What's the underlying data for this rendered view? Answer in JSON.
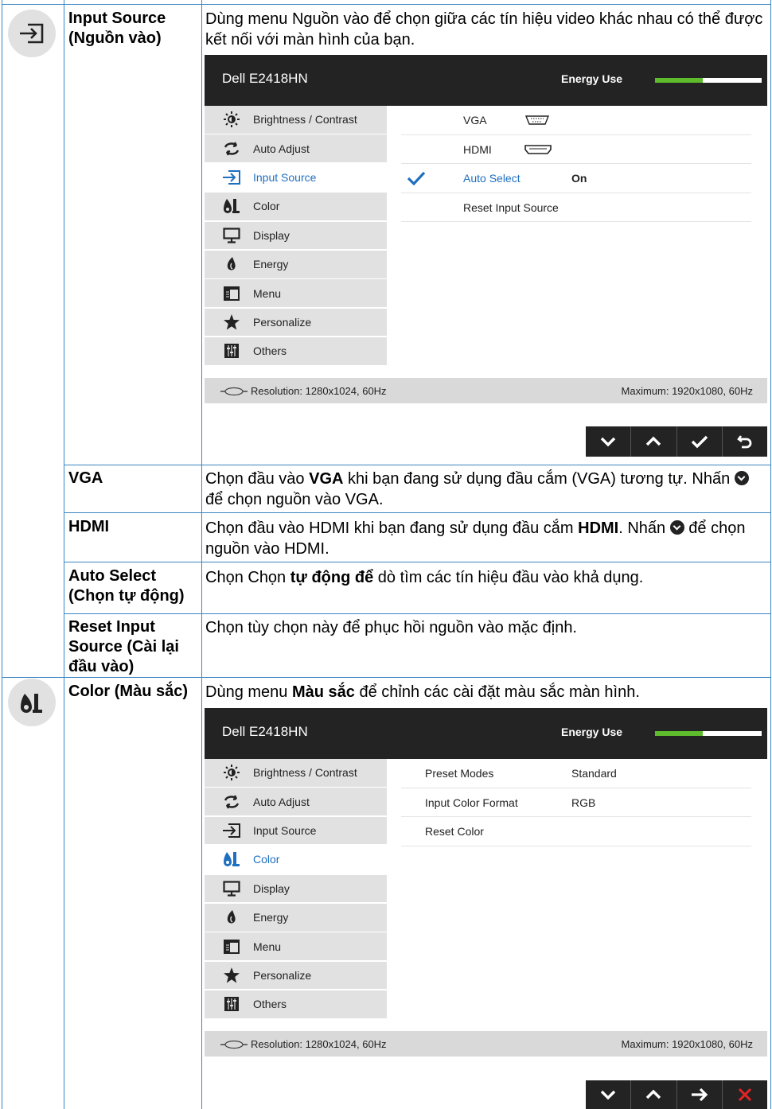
{
  "section1": {
    "label": "Input Source (Nguồn vào)",
    "description": "Dùng menu Nguồn vào để chọn giữa các tín hiệu video khác nhau có thể được kết nối với màn hình của bạn.",
    "osd": {
      "model": "Dell E2418HN",
      "energy_label": "Energy Use",
      "energy_level": 0.45,
      "menu": [
        "Brightness / Contrast",
        "Auto Adjust",
        "Input Source",
        "Color",
        "Display",
        "Energy",
        "Menu",
        "Personalize",
        "Others"
      ],
      "active_index": 2,
      "submenu": {
        "vga": "VGA",
        "hdmi": "HDMI",
        "auto_select": "Auto Select",
        "auto_select_value": "On",
        "reset": "Reset Input Source"
      },
      "resolution": "Resolution: 1280x1024, 60Hz",
      "maximum": "Maximum: 1920x1080, 60Hz"
    },
    "rows": [
      {
        "label": "VGA",
        "pre": "Chọn đầu vào ",
        "bold": "VGA",
        "post": " khi bạn đang sử dụng đầu cắm (VGA) tương tự. Nhấn ",
        "tail": " để chọn nguồn vào VGA."
      },
      {
        "label": "HDMI",
        "pre": "Chọn đầu vào HDMI khi bạn đang sử dụng đầu cắm ",
        "bold": "HDMI",
        "post": ". Nhấn ",
        "tail": " để chọn nguồn vào HDMI."
      },
      {
        "label": "Auto Select (Chọn tự động)",
        "pre": "Chọn Chọn ",
        "bold": "tự động để",
        "post": " dò tìm các tín hiệu đầu vào khả dụng."
      },
      {
        "label": "Reset Input Source (Cài lại đầu vào)",
        "pre": "Chọn tùy chọn này để phục hồi nguồn vào mặc định."
      }
    ]
  },
  "section2": {
    "label": "Color (Màu sắc)",
    "desc_pre": "Dùng menu ",
    "desc_bold": "Màu sắc",
    "desc_post": " để chỉnh các cài đặt màu sắc màn hình.",
    "osd": {
      "model": "Dell E2418HN",
      "energy_label": "Energy Use",
      "energy_level": 0.45,
      "menu": [
        "Brightness / Contrast",
        "Auto Adjust",
        "Input Source",
        "Color",
        "Display",
        "Energy",
        "Menu",
        "Personalize",
        "Others"
      ],
      "active_index": 3,
      "submenu": [
        {
          "name": "Preset Modes",
          "value": "Standard"
        },
        {
          "name": "Input Color Format",
          "value": "RGB"
        },
        {
          "name": "Reset Color",
          "value": ""
        }
      ],
      "resolution": "Resolution: 1280x1024, 60Hz",
      "maximum": "Maximum: 1920x1080, 60Hz"
    }
  },
  "colors": {
    "accent": "#1e6fc0",
    "energy_bar": "#5ebc2c",
    "osd_dark": "#232323",
    "table_border": "#3b86c4",
    "exit_red": "#e32424"
  }
}
